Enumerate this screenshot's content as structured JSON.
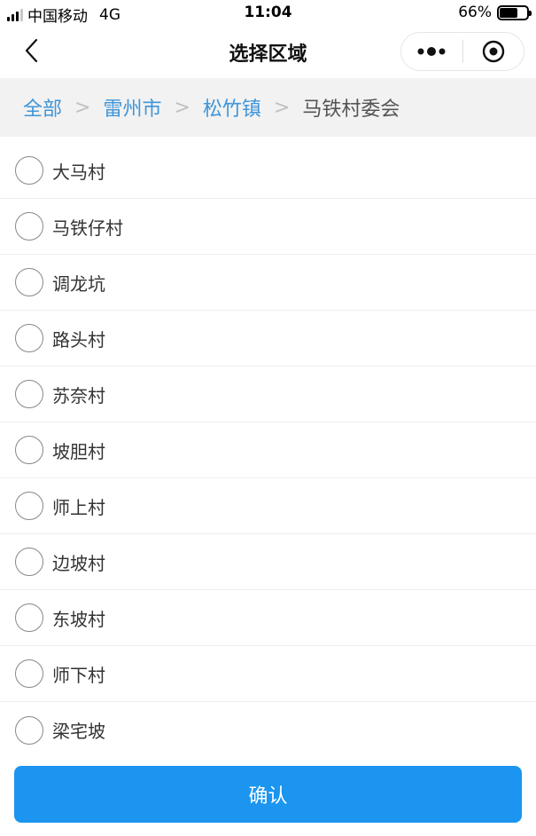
{
  "status_bar": {
    "carrier": "中国移动",
    "network": "4G",
    "time": "11:04",
    "battery_percent": "66%",
    "battery_level": 0.66
  },
  "nav": {
    "title": "选择区域",
    "back_icon": "chevron-left-icon",
    "more_icon": "more-dots-icon",
    "close_icon": "target-circle-icon"
  },
  "breadcrumb": {
    "items": [
      "全部",
      "雷州市",
      "松竹镇"
    ],
    "current": "马铁村委会",
    "separator": ">",
    "link_color": "#3f95d8"
  },
  "options": [
    {
      "label": "大马村"
    },
    {
      "label": "马铁仔村"
    },
    {
      "label": "调龙坑"
    },
    {
      "label": "路头村"
    },
    {
      "label": "苏奈村"
    },
    {
      "label": "坡胆村"
    },
    {
      "label": "师上村"
    },
    {
      "label": "边坡村"
    },
    {
      "label": "东坡村"
    },
    {
      "label": "师下村"
    },
    {
      "label": "梁宅坡"
    }
  ],
  "confirm": {
    "label": "确认",
    "color": "#1b95f0"
  }
}
